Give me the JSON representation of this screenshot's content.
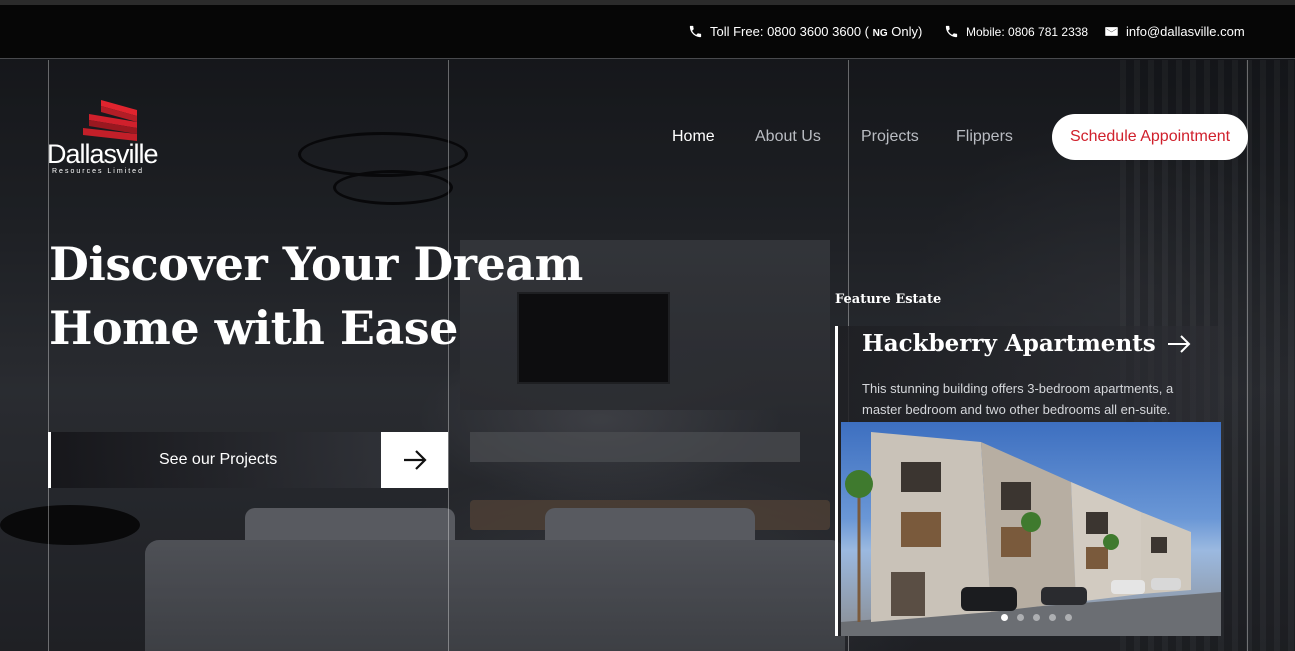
{
  "topbar": {
    "toll_free_prefix": "Toll Free: 0800 3600 3600 (",
    "toll_free_region": "NG",
    "toll_free_suffix": "Only)",
    "mobile": "Mobile: 0806 781 2338",
    "email": "info@dallasville.com"
  },
  "logo": {
    "name": "Dallasville",
    "subtitle": "Resources Limited"
  },
  "nav": {
    "items": [
      {
        "label": "Home",
        "active": true
      },
      {
        "label": "About Us",
        "active": false
      },
      {
        "label": "Projects",
        "active": false
      },
      {
        "label": "Flippers",
        "active": false
      }
    ],
    "cta": "Schedule Appointment"
  },
  "hero": {
    "headline_line1": "Discover Your Dream",
    "headline_line2": "Home with Ease",
    "projects_button": "See our Projects"
  },
  "feature": {
    "label": "Feature Estate",
    "title": "Hackberry Apartments",
    "description": "This stunning building offers 3-bedroom apartments, a master bedroom and two other bedrooms all en-suite.",
    "carousel": {
      "count": 5,
      "active_index": 0
    }
  },
  "colors": {
    "brand_red": "#d0202c",
    "logo_red": "#c8202a",
    "topbar_bg": "#060606"
  }
}
